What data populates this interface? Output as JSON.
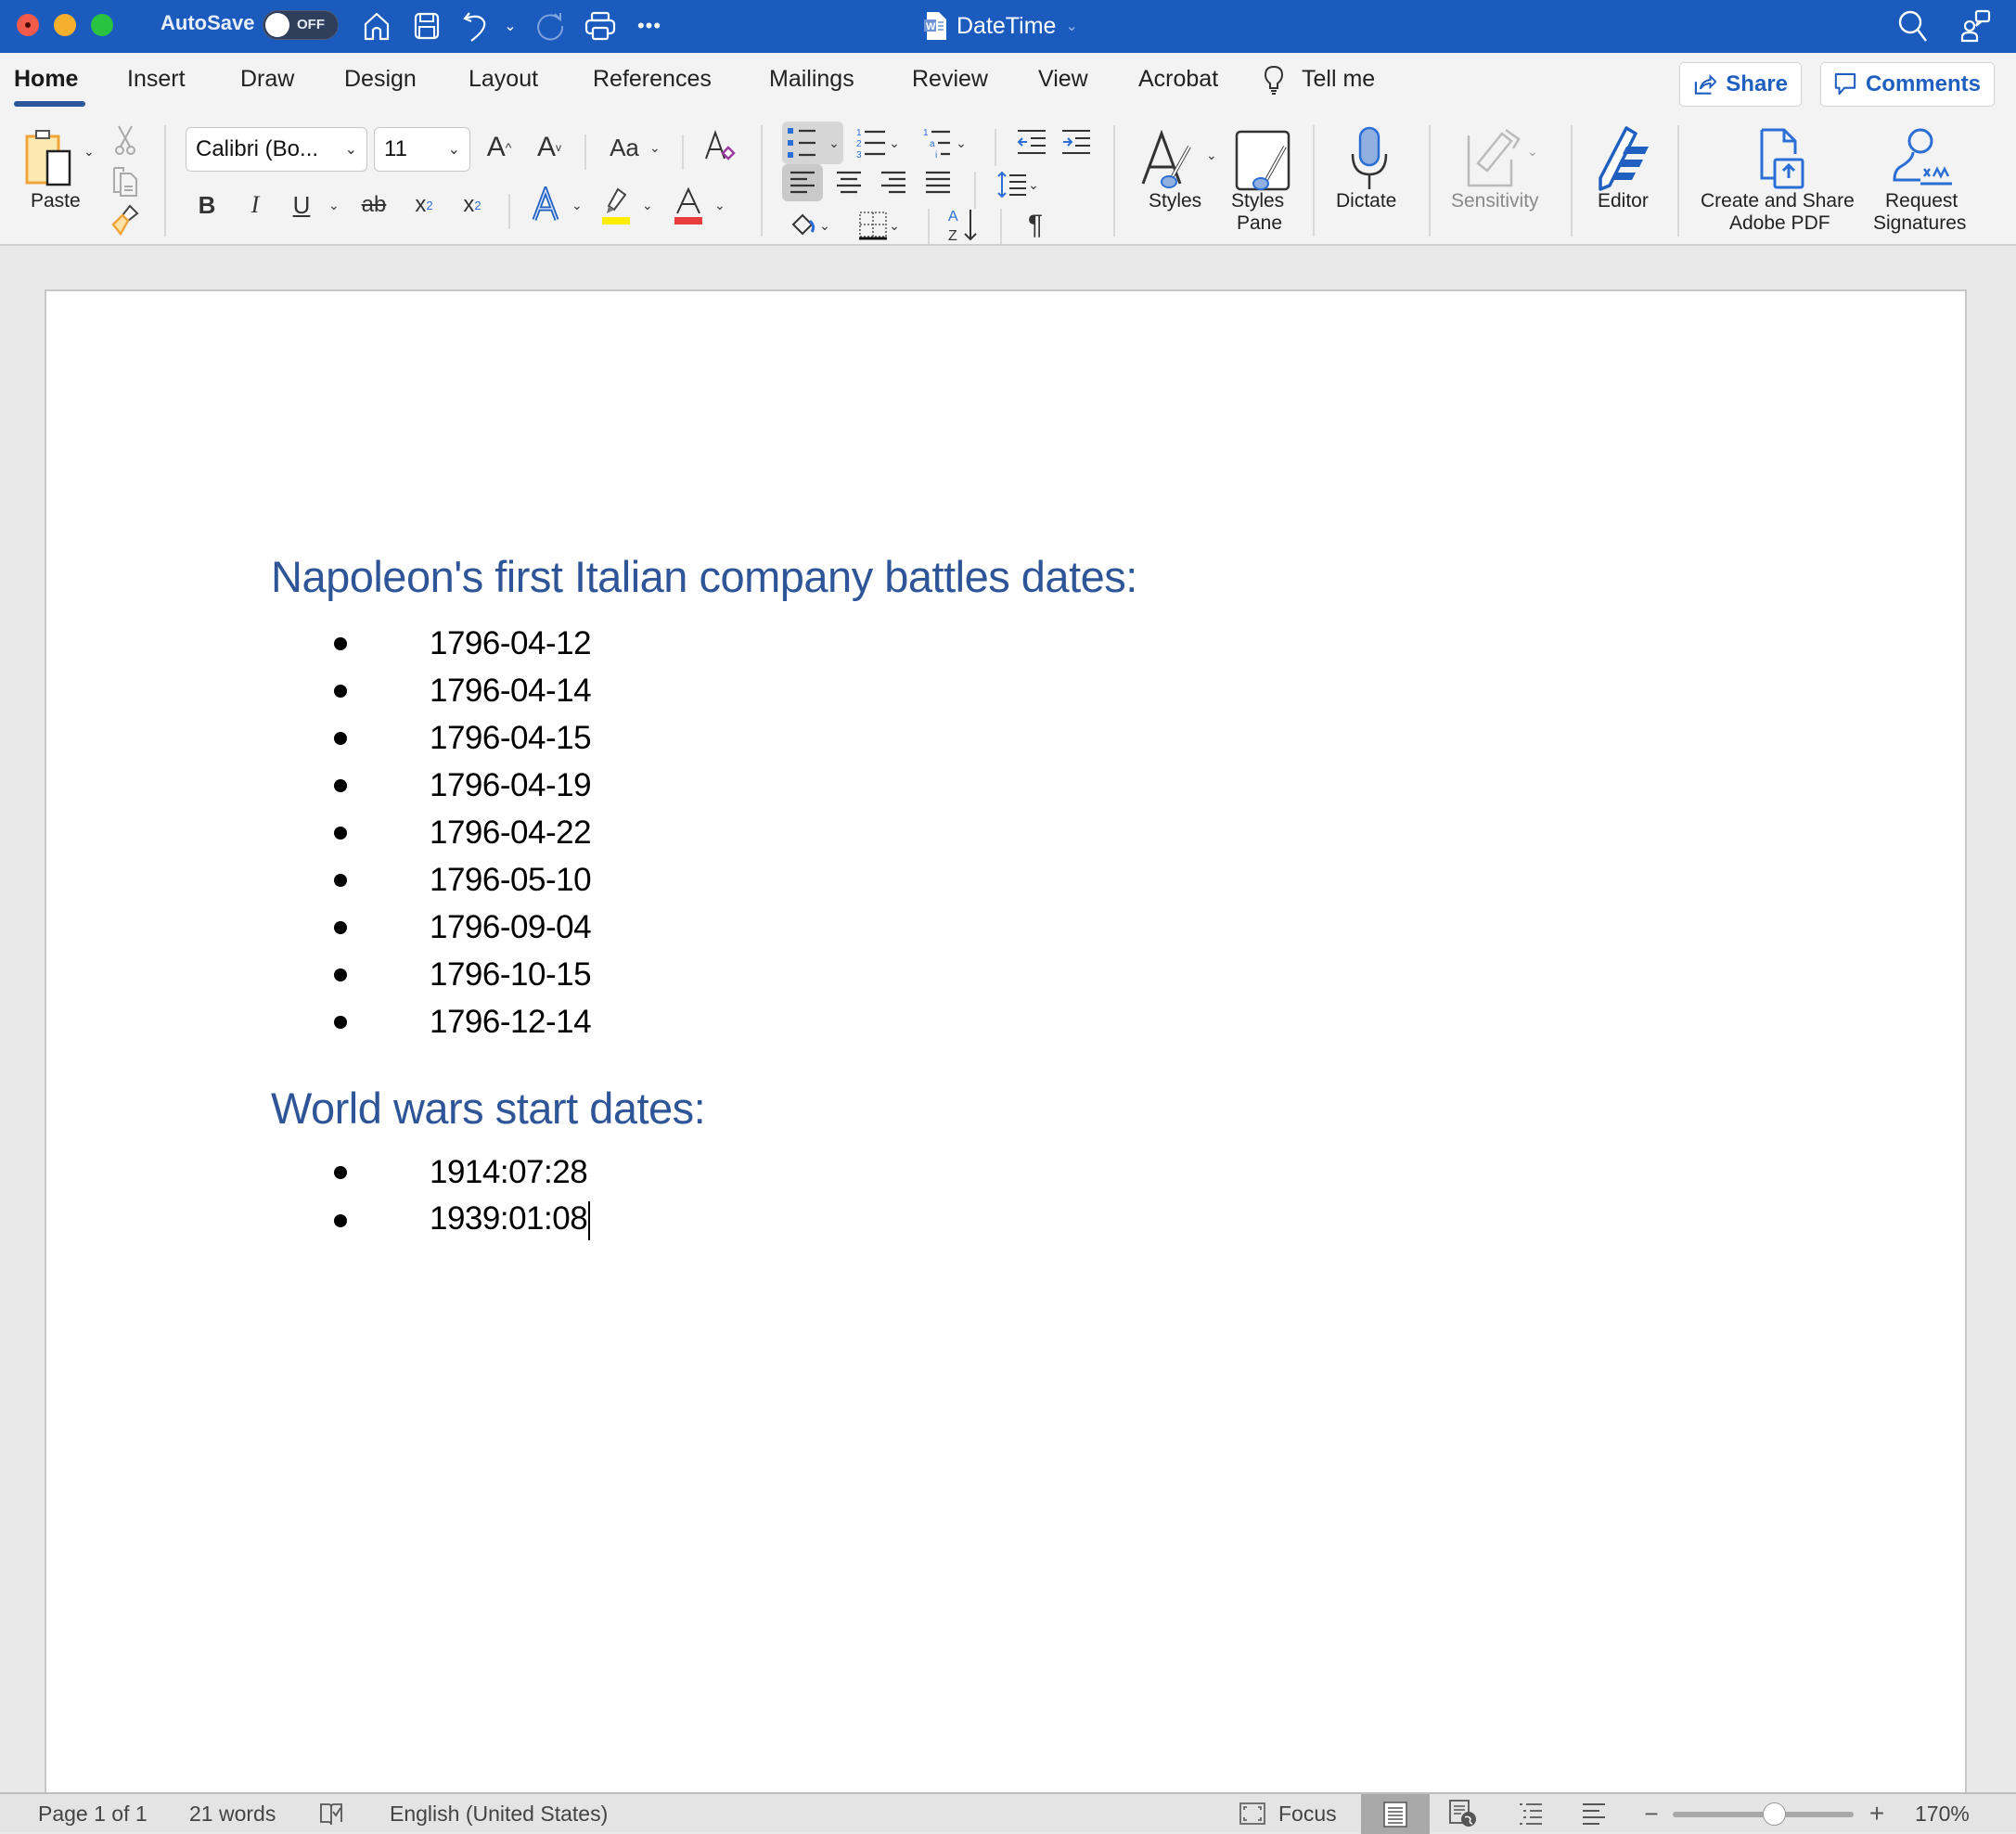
{
  "titlebar": {
    "autosave_label": "AutoSave",
    "autosave_state": "OFF",
    "doc_title": "DateTime",
    "accent_color": "#1b5bbd",
    "quick_access": [
      "home-icon",
      "save-icon",
      "undo-icon",
      "undo-dropdown",
      "redo-icon",
      "print-icon",
      "more-icon"
    ],
    "right_icons": [
      "search-icon",
      "share-people-icon"
    ]
  },
  "tabs": [
    {
      "label": "Home",
      "active": true
    },
    {
      "label": "Insert"
    },
    {
      "label": "Draw"
    },
    {
      "label": "Design"
    },
    {
      "label": "Layout"
    },
    {
      "label": "References"
    },
    {
      "label": "Mailings"
    },
    {
      "label": "Review"
    },
    {
      "label": "View"
    },
    {
      "label": "Acrobat"
    },
    {
      "label": "Tell me"
    }
  ],
  "header_buttons": {
    "share": "Share",
    "comments": "Comments"
  },
  "ribbon": {
    "paste": "Paste",
    "font_name": "Calibri (Bo...",
    "font_size": "11",
    "change_case": "Aa",
    "styles": "Styles",
    "styles_pane_line1": "Styles",
    "styles_pane_line2": "Pane",
    "dictate": "Dictate",
    "sensitivity": "Sensitivity",
    "editor": "Editor",
    "create_pdf_line1": "Create and Share",
    "create_pdf_line2": "Adobe PDF",
    "request_sig_line1": "Request",
    "request_sig_line2": "Signatures",
    "bold": "B",
    "italic": "I",
    "underline": "U",
    "strikethrough": "ab",
    "subscript": "x",
    "superscript": "x",
    "highlight_color": "#ffee00",
    "font_color": "#e83b3b"
  },
  "document": {
    "heading1": "Napoleon's first Italian company battles dates:",
    "list1": [
      "1796-04-12",
      "1796-04-14",
      "1796-04-15",
      "1796-04-19",
      "1796-04-22",
      "1796-05-10",
      "1796-09-04",
      "1796-10-15",
      "1796-12-14"
    ],
    "heading2": "World wars start dates:",
    "list2": [
      "1914:07:28",
      "1939:01:08"
    ],
    "heading_color": "#2e5597"
  },
  "statusbar": {
    "page": "Page 1 of 1",
    "words": "21 words",
    "language": "English (United States)",
    "focus": "Focus",
    "zoom": "170%",
    "zoom_percent": 170
  }
}
